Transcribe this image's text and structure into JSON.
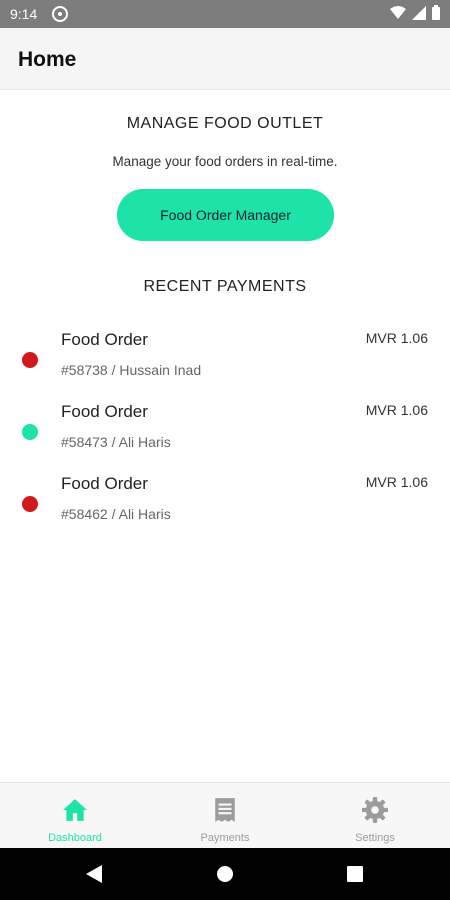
{
  "status_bar": {
    "time": "9:14"
  },
  "app_bar": {
    "title": "Home"
  },
  "manage_section": {
    "title": "MANAGE FOOD OUTLET",
    "subtitle": "Manage your food orders in real-time.",
    "button_label": "Food Order Manager"
  },
  "payments_section": {
    "title": "RECENT PAYMENTS",
    "items": [
      {
        "title": "Food Order",
        "subtitle": "#58738 / Hussain Inad",
        "amount": "MVR 1.06",
        "status_color": "#d0191b"
      },
      {
        "title": "Food Order",
        "subtitle": "#58473 / Ali Haris",
        "amount": "MVR 1.06",
        "status_color": "#1de3a9"
      },
      {
        "title": "Food Order",
        "subtitle": "#58462 / Ali Haris",
        "amount": "MVR 1.06",
        "status_color": "#d0191b"
      }
    ]
  },
  "bottom_nav": {
    "items": [
      {
        "label": "Dashboard",
        "icon": "home-icon",
        "active": true
      },
      {
        "label": "Payments",
        "icon": "receipt-icon",
        "active": false
      },
      {
        "label": "Settings",
        "icon": "gear-icon",
        "active": false
      }
    ]
  },
  "colors": {
    "accent": "#1de3a9",
    "danger": "#d0191b",
    "inactive_icon": "#9c9c9c"
  }
}
